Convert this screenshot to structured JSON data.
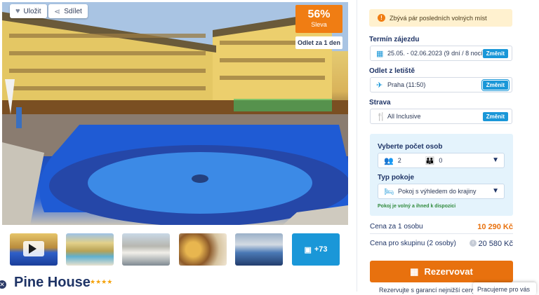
{
  "gallery": {
    "save_label": "Uložit",
    "share_label": "Sdílet",
    "discount_pct": "56%",
    "discount_label": "Sleva",
    "departure_badge": "Odlet za 1 den",
    "more_photos": "+73"
  },
  "hotel": {
    "name": "Pine House",
    "stars": "★★★★"
  },
  "booking": {
    "alert": "Zbývá pár posledních volných míst",
    "term_label": "Termín zájezdu",
    "term_value": "25.05. - 02.06.2023 (9 dní / 8 nocí)",
    "airport_label": "Odlet z letiště",
    "airport_value": "Praha (11:50)",
    "board_label": "Strava",
    "board_value": "All Inclusive",
    "change_label": "Změnit",
    "persons_label": "Vyberte počet osob",
    "adults": "2",
    "children": "0",
    "room_label": "Typ pokoje",
    "room_value": "Pokoj s výhledem do krajiny",
    "availability": "Pokoj je volný a ihned k dispozici",
    "price_person_label": "Cena za 1 osobu",
    "price_person_value": "10 290 Kč",
    "price_group_label": "Cena pro skupinu (2 osoby)",
    "price_group_value": "20 580 Kč",
    "reserve_label": "Rezervovat",
    "guarantee": "Rezervujte s garancí nejnižší ceny!"
  },
  "chat": {
    "label": "Pracujeme pro vás"
  },
  "colors": {
    "accent": "#e8710e",
    "primary": "#1a97d8",
    "discount": "#f07d13",
    "heading": "#1f3466"
  }
}
